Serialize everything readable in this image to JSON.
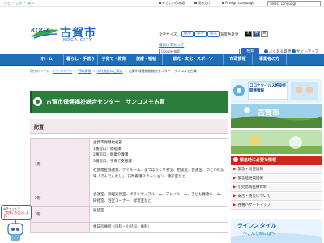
{
  "topbar": {
    "tagline": "ひと ・ こが ・ 育つ",
    "links": [
      {
        "label": "やさしい日本語"
      },
      {
        "label": "読み上げ"
      },
      {
        "label": "Foreign Language"
      }
    ],
    "language_select": "Select Language"
  },
  "header": {
    "logo_mark": "KOGA",
    "logo_name": "古賀市",
    "logo_city": "KOGA CITY",
    "font_size_label": "文字サイズ",
    "font_size_buttons": [
      "縮小",
      "標準",
      "拡大"
    ],
    "color_label": "背景色変更",
    "color_buttons": [
      "黒",
      "青",
      "白"
    ],
    "search_title": "検索にあたって",
    "search_placeholder": "Google 検索",
    "search_button": "検索",
    "header_links": [
      "よくある質問",
      "サイトマップ"
    ]
  },
  "nav": {
    "items": [
      "ホーム",
      "暮らし・手続き",
      "子育て・教育",
      "健康・福祉",
      "観光・文化・スポーツ",
      "市政情報",
      "事業者の方"
    ]
  },
  "breadcrumb": {
    "lead": "現在のページ",
    "items": [
      "トップページ",
      "行政情報",
      "公共施設のご案内"
    ],
    "current": "古賀市保健福祉総合センター　サンコスモ古賀"
  },
  "main": {
    "page_title": "古賀市保健福祉総合センター　サンコスモ古賀",
    "section_title": "配置",
    "table": {
      "rows": [
        {
          "floor": "1階",
          "lines": [
            "古賀市保健福祉部",
            "1番窓口：福祉課",
            "2番窓口：健康介護課",
            "3番窓口：子育て支援課",
            "",
            "社会福祉協議会、デイルーム、まつぼっくり食堂、相談室、会議室、つどいの広場「でんでんむし」、訪問看護ステーション、健診室など"
          ]
        },
        {
          "floor": "2階",
          "lines": [
            "会議室、調理実習室、ボランティアルーム、プレイルーム、子ども発達ルーム、研修室、浴室コーナー、録音室など"
          ]
        },
        {
          "floor": "3階",
          "lines": [
            "展望室"
          ]
        },
        {
          "floor": "",
          "lines": [
            "休日診療所（内科・小児科・歯科）"
          ]
        }
      ]
    }
  },
  "sidebar": {
    "banner1_text": "コロナウイルス感染症関連情報",
    "banner2_text": "古賀市",
    "banner3_text": "",
    "emergency_title": "緊急時に必要な情報",
    "emergency_items": [
      "緊急・災害情報",
      "緊急連絡電話帳",
      "小児急病医療体制",
      "安否・防災について",
      "各種ハザードマップ"
    ],
    "life_title": "ライフスタイル",
    "life_subtitle": "〜こんな時には〜"
  },
  "ai_chat": {
    "line1": "AIチャットで",
    "line2": "ご質問にお答えします！"
  }
}
